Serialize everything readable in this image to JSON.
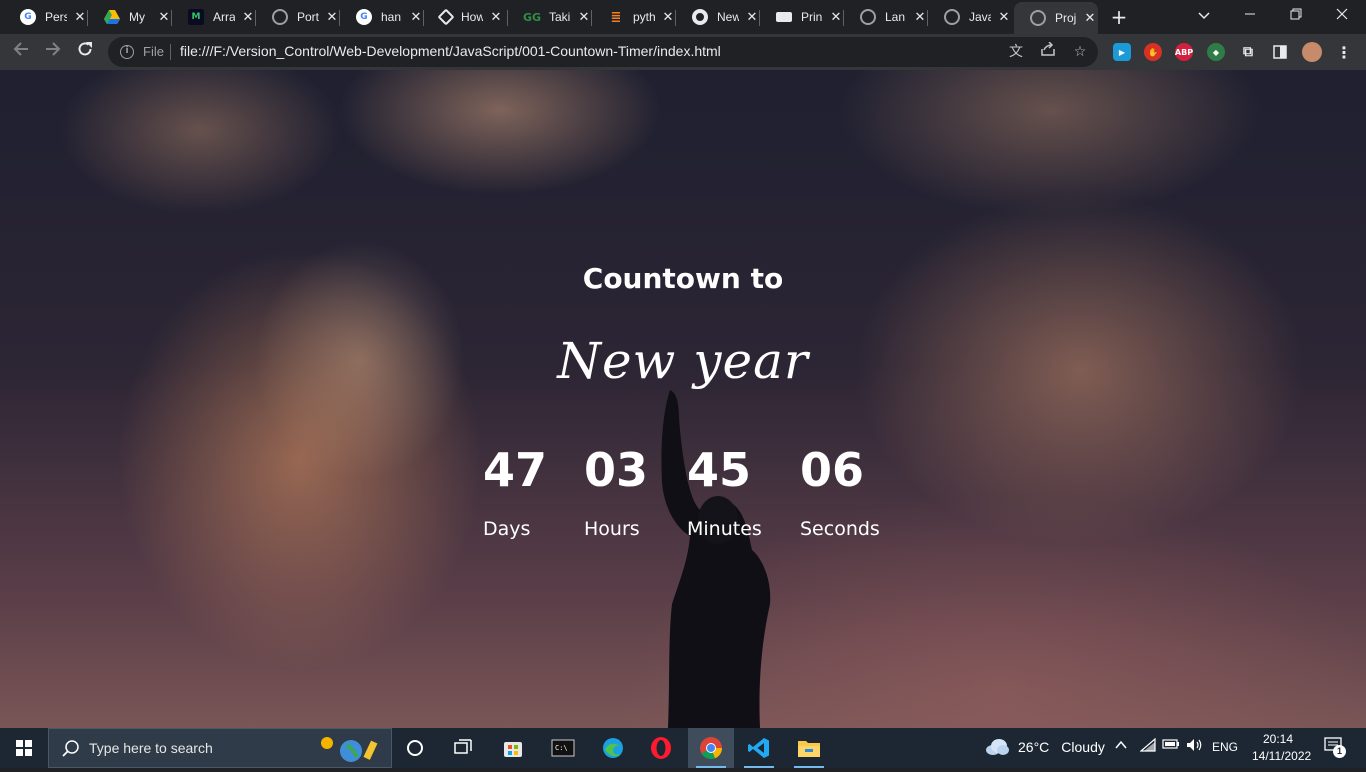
{
  "browser": {
    "tabs": [
      {
        "title": "Pers",
        "icon": "google-icon",
        "color": "#ffffff"
      },
      {
        "title": "My",
        "icon": "google-drive-icon",
        "color": "#fbbc04"
      },
      {
        "title": "Arra",
        "icon": "codepen-icon",
        "color": "#2ec866"
      },
      {
        "title": "Port",
        "icon": "globe-icon",
        "color": "#9aa0a6"
      },
      {
        "title": "han",
        "icon": "google-icon",
        "color": "#ffffff"
      },
      {
        "title": "How",
        "icon": "diamond-icon",
        "color": "#e8eaed"
      },
      {
        "title": "Taki",
        "icon": "geeksforgeeks-icon",
        "color": "#2f8d46"
      },
      {
        "title": "pyth",
        "icon": "stackoverflow-icon",
        "color": "#f48024"
      },
      {
        "title": "New",
        "icon": "chrome-icon",
        "color": "#e8eaed"
      },
      {
        "title": "Prin",
        "icon": "printer-icon",
        "color": "#e8eaed"
      },
      {
        "title": "Lan",
        "icon": "globe-icon",
        "color": "#9aa0a6"
      },
      {
        "title": "Java",
        "icon": "globe-icon",
        "color": "#9aa0a6"
      },
      {
        "title": "Proj",
        "icon": "globe-icon",
        "color": "#9aa0a6",
        "active": true
      }
    ],
    "close_glyph": "✕",
    "new_tab_glyph": "+",
    "address": {
      "scheme_label": "File",
      "url": "file:///F:/Version_Control/Web-Development/JavaScript/001-Countown-Timer/index.html"
    }
  },
  "page": {
    "heading": "Countown to",
    "subheading": "New year",
    "units": [
      {
        "value": "47",
        "label": "Days"
      },
      {
        "value": "03",
        "label": "Hours"
      },
      {
        "value": "45",
        "label": "Minutes"
      },
      {
        "value": "06",
        "label": "Seconds"
      }
    ]
  },
  "taskbar": {
    "search_placeholder": "Type here to search",
    "weather": {
      "temp": "26°C",
      "condition": "Cloudy"
    },
    "language": "ENG",
    "clock": {
      "time": "20:14",
      "date": "14/11/2022"
    },
    "notification_count": "1"
  }
}
